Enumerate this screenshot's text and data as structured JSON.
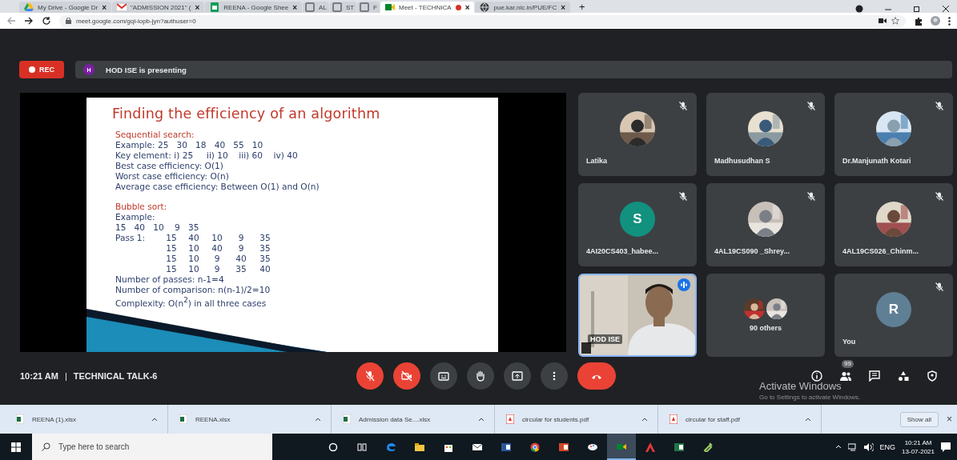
{
  "browser": {
    "tabs": [
      {
        "title": "My Drive - Google Dr",
        "close": "×",
        "selected": false
      },
      {
        "title": "\"ADMISSION 2021\" (",
        "close": "×",
        "selected": false
      },
      {
        "title": "REENA - Google Shee",
        "close": "×",
        "selected": false
      },
      {
        "title": "AL",
        "selected": false
      },
      {
        "title": "ST",
        "selected": false
      },
      {
        "title": "F",
        "selected": false
      },
      {
        "title": "Meet - TECHNICA",
        "close": "×",
        "selected": true,
        "recording": true
      },
      {
        "title": "pue.kar.nic.in/PUE/FC",
        "close": "×",
        "selected": false
      }
    ],
    "new_tab": "+",
    "address": "meet.google.com/gqi-iopb-jyn?authuser=0"
  },
  "meet": {
    "recording": {
      "label": "REC"
    },
    "presenter": {
      "initial": "H",
      "text": "HOD ISE is presenting"
    },
    "slide": {
      "title": "Finding the efficiency of an algorithm",
      "sections": [
        {
          "heading": "Sequential search:",
          "items": [
            {
              "kind": "text",
              "text": "Example: 25   30   18   40   55   10"
            },
            {
              "kind": "text",
              "text": "Key element: i) 25     ii) 10    iii) 60    iv) 40"
            },
            {
              "kind": "text",
              "text": "Best case efficiency: O(1)"
            },
            {
              "kind": "text",
              "text": "Worst case efficiency: O(n)"
            },
            {
              "kind": "text",
              "text": "Average case efficiency: Between O(1) and O(n)"
            }
          ]
        },
        {
          "heading": "Bubble sort:",
          "items": [
            {
              "kind": "text",
              "text": "Example:"
            },
            {
              "kind": "text",
              "text": "15   40   10    9   35"
            },
            {
              "kind": "grid",
              "label": "Pass 1:",
              "rows": [
                [
                  "15",
                  "40",
                  "10",
                  "9",
                  "35"
                ],
                [
                  "15",
                  "10",
                  "40",
                  "9",
                  "35"
                ],
                [
                  "15",
                  "10",
                  "9",
                  "40",
                  "35"
                ],
                [
                  "15",
                  "10",
                  "9",
                  "35",
                  "40"
                ]
              ]
            },
            {
              "kind": "text",
              "text": "Number of passes: n-1=4"
            },
            {
              "kind": "text",
              "text": "Number of comparison: n(n-1)/2=10"
            },
            {
              "kind": "text",
              "text": "Complexity: O(n$^{2}$) in all three cases"
            }
          ]
        }
      ]
    },
    "tiles": [
      {
        "name": "Latika",
        "muted": true,
        "speaking": false
      },
      {
        "name": "Madhusudhan S",
        "muted": true,
        "speaking": false
      },
      {
        "name": "Dr.Manjunath Kotari",
        "muted": true,
        "speaking": false
      },
      {
        "name": "4AI20CS403_habee...",
        "kind": "letter",
        "initial": "S",
        "color": "#12917f",
        "muted": true,
        "speaking": false
      },
      {
        "name": "4AL19CS090 _Shrey...",
        "muted": true,
        "speaking": false
      },
      {
        "name": "4AL19CS026_Chinm...",
        "muted": true,
        "speaking": false
      },
      {
        "name": "HOD ISE",
        "kind": "video",
        "muted": false,
        "speaking": true
      },
      {
        "name": "90 others",
        "kind": "others",
        "muted": false,
        "speaking": false
      },
      {
        "name": "You",
        "kind": "letter",
        "initial": "R",
        "color": "#5f7f95",
        "muted": true,
        "speaking": false
      }
    ],
    "time": "10:21 AM",
    "separator": "|",
    "meeting_title": "TECHNICAL TALK-6",
    "controls": [
      {
        "kind": "mic",
        "on": false
      },
      {
        "kind": "camera",
        "on": false
      },
      {
        "kind": "captions"
      },
      {
        "kind": "hand"
      },
      {
        "kind": "present"
      },
      {
        "kind": "more"
      },
      {
        "kind": "end"
      }
    ],
    "side_controls": [
      {
        "kind": "info"
      },
      {
        "kind": "people",
        "badge": "99"
      },
      {
        "kind": "chat"
      },
      {
        "kind": "activities"
      },
      {
        "kind": "safety"
      }
    ]
  },
  "os_notice": {
    "title": "Activate Windows",
    "text": "Go to Settings to activate Windows."
  },
  "downloads": {
    "files": [
      {
        "name": "REENA (1).xlsx",
        "kind": "xlsx"
      },
      {
        "name": "REENA.xlsx",
        "kind": "xlsx"
      },
      {
        "name": "Admission data Se....xlsx",
        "kind": "xlsx"
      },
      {
        "name": "circular for students.pdf",
        "kind": "pdf"
      },
      {
        "name": "circular for staff.pdf",
        "kind": "pdf"
      }
    ],
    "show_all": "Show all",
    "close": "×"
  },
  "taskbar": {
    "search_placeholder": "Type here to search",
    "apps": [
      {
        "selected": false
      },
      {
        "selected": false
      },
      {
        "selected": false
      },
      {
        "selected": false
      },
      {
        "selected": false
      },
      {
        "selected": false
      },
      {
        "selected": false
      },
      {
        "selected": false
      },
      {
        "selected": false
      },
      {
        "selected": false
      },
      {
        "selected": true
      },
      {
        "selected": false
      },
      {
        "selected": false
      },
      {
        "selected": false
      }
    ],
    "language": "ENG",
    "time": "10:21 AM",
    "date": "13-07-2021"
  }
}
